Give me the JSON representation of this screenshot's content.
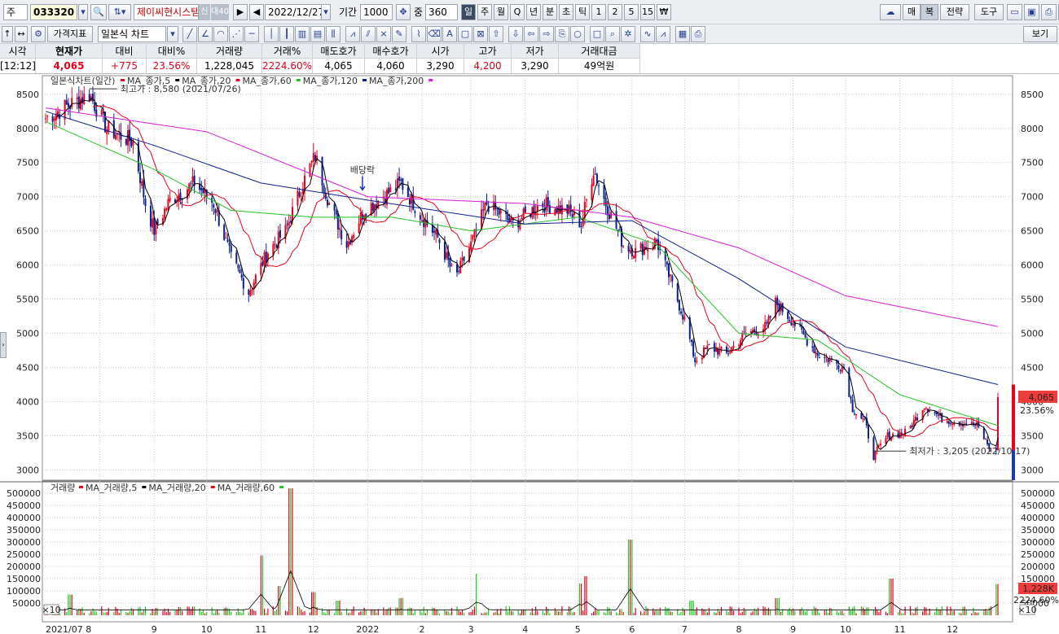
{
  "toolbar1": {
    "market_label": "주",
    "code": "033320",
    "name": "제이씨현시스템",
    "badge_credit": "신",
    "badge_margin": "대40",
    "date": "2022/12/27",
    "period_label": "기간",
    "period_value": "1000",
    "overlap_label": "중",
    "overlap_value": "360",
    "periods": [
      "일",
      "주",
      "월",
      "Q",
      "년",
      "분",
      "초",
      "틱",
      "1",
      "2",
      "5",
      "15",
      "₩"
    ],
    "right_buttons": [
      "매",
      "복",
      "전략",
      "도구"
    ]
  },
  "toolbar2": {
    "indicator_button": "가격지표",
    "chart_type": "일본식 차트",
    "view_button": "보기"
  },
  "quote": {
    "headers": [
      "시각",
      "현재가",
      "대비",
      "대비%",
      "거래량",
      "거래%",
      "매도호가",
      "매수호가",
      "시가",
      "고가",
      "저가",
      "거래대금"
    ],
    "values": [
      "[12:12]",
      "4,065",
      "+775",
      "23.56%",
      "1,228,045",
      "2224.60%",
      "4,065",
      "4,060",
      "3,290",
      "4,200",
      "3,290",
      "49억원"
    ]
  },
  "price_legend": {
    "title": "일본식차트(일간)",
    "items": [
      {
        "label": "MA_종가,5",
        "color": "#e8001c"
      },
      {
        "label": "MA_종가,20",
        "color": "#000000"
      },
      {
        "label": "MA_종가,60",
        "color": "#e8001c"
      },
      {
        "label": "MA_종가,120",
        "color": "#22c322"
      },
      {
        "label": "MA_종가,200",
        "color": "#0b1f8f"
      }
    ],
    "last_marker_color": "#d81bd8"
  },
  "annotations": {
    "high": "최고가 : 8,580 (2021/07/26)",
    "low": "최저가 : 3,205 (2022/10/17)",
    "dividend": "배당락"
  },
  "price_badge": {
    "price": "4,065",
    "change": "23.56%"
  },
  "volume_legend": {
    "title": "거래량",
    "items": [
      {
        "label": "MA_거래량,5",
        "color": "#e8001c"
      },
      {
        "label": "MA_거래량,20",
        "color": "#000000"
      },
      {
        "label": "MA_거래량,60",
        "color": "#e8001c"
      }
    ],
    "last_marker_color": "#22c322"
  },
  "volume_badge": {
    "volume": "1,228K",
    "ratio": "2224.60%"
  },
  "scale_tag": "×10",
  "colors": {
    "up": "#e8001c",
    "down": "#0b1f8f",
    "ma5": "#e8001c",
    "ma20": "#000000",
    "ma60": "#e8001c",
    "ma120": "#22c322",
    "ma200": "#0b1f8f",
    "ma200_alt": "#d81bd8"
  },
  "chart_data": [
    {
      "type": "candlestick",
      "title": "일본식차트(일간)",
      "y_ticks": [
        8500,
        8000,
        7500,
        7000,
        6500,
        6000,
        5500,
        5000,
        4500,
        4000,
        3500,
        3000
      ],
      "ylim": [
        2850,
        8700
      ],
      "x_ticks": [
        "2021/07 8",
        "9",
        "10",
        "11",
        "12",
        "2022",
        "2",
        "3",
        "4",
        "5",
        "6",
        "7",
        "8",
        "9",
        "10",
        "11",
        "12"
      ],
      "close_path": [
        [
          "2021-07-01",
          8150
        ],
        [
          "2021-07-15",
          8350
        ],
        [
          "2021-07-26",
          8500
        ],
        [
          "2021-08-05",
          8000
        ],
        [
          "2021-08-20",
          7800
        ],
        [
          "2021-08-27",
          6900
        ],
        [
          "2021-09-01",
          6500
        ],
        [
          "2021-09-10",
          6950
        ],
        [
          "2021-09-24",
          7200
        ],
        [
          "2021-10-05",
          6900
        ],
        [
          "2021-10-15",
          6100
        ],
        [
          "2021-10-25",
          5600
        ],
        [
          "2021-11-05",
          6200
        ],
        [
          "2021-11-15",
          6500
        ],
        [
          "2021-11-25",
          7200
        ],
        [
          "2021-12-02",
          7600
        ],
        [
          "2021-12-10",
          6900
        ],
        [
          "2021-12-20",
          6300
        ],
        [
          "2021-12-30",
          6800
        ],
        [
          "2022-01-10",
          7000
        ],
        [
          "2022-01-20",
          7200
        ],
        [
          "2022-02-01",
          6700
        ],
        [
          "2022-02-10",
          6400
        ],
        [
          "2022-02-20",
          5800
        ],
        [
          "2022-03-01",
          6300
        ],
        [
          "2022-03-10",
          6900
        ],
        [
          "2022-03-25",
          6600
        ],
        [
          "2022-04-10",
          6900
        ],
        [
          "2022-04-25",
          6800
        ],
        [
          "2022-05-03",
          6600
        ],
        [
          "2022-05-10",
          7400
        ],
        [
          "2022-05-17",
          6900
        ],
        [
          "2022-05-27",
          6300
        ],
        [
          "2022-06-03",
          6200
        ],
        [
          "2022-06-15",
          6350
        ],
        [
          "2022-06-24",
          5700
        ],
        [
          "2022-07-01",
          5200
        ],
        [
          "2022-07-07",
          4600
        ],
        [
          "2022-07-15",
          4800
        ],
        [
          "2022-07-25",
          4700
        ],
        [
          "2022-08-05",
          5000
        ],
        [
          "2022-08-17",
          5100
        ],
        [
          "2022-08-22",
          5450
        ],
        [
          "2022-08-31",
          5200
        ],
        [
          "2022-09-15",
          4700
        ],
        [
          "2022-09-30",
          4500
        ],
        [
          "2022-10-05",
          3900
        ],
        [
          "2022-10-12",
          3700
        ],
        [
          "2022-10-17",
          3205
        ],
        [
          "2022-10-25",
          3500
        ],
        [
          "2022-11-05",
          3550
        ],
        [
          "2022-11-15",
          3950
        ],
        [
          "2022-11-25",
          3750
        ],
        [
          "2022-12-05",
          3700
        ],
        [
          "2022-12-15",
          3650
        ],
        [
          "2022-12-23",
          3290
        ],
        [
          "2022-12-27",
          4065
        ]
      ],
      "ma200_path": [
        [
          "2021-07-01",
          8300
        ],
        [
          "2021-10-01",
          7950
        ],
        [
          "2022-01-01",
          7000
        ],
        [
          "2022-04-01",
          6900
        ],
        [
          "2022-06-01",
          6700
        ],
        [
          "2022-08-01",
          6250
        ],
        [
          "2022-10-01",
          5550
        ],
        [
          "2022-12-27",
          5100
        ]
      ],
      "ma120_path": [
        [
          "2021-07-01",
          8250
        ],
        [
          "2021-09-01",
          7750
        ],
        [
          "2021-11-01",
          7200
        ],
        [
          "2022-01-01",
          6950
        ],
        [
          "2022-04-01",
          6600
        ],
        [
          "2022-06-01",
          6650
        ],
        [
          "2022-08-01",
          5800
        ],
        [
          "2022-10-01",
          4800
        ],
        [
          "2022-12-27",
          4250
        ]
      ],
      "ma60_path": [
        [
          "2021-07-01",
          8100
        ],
        [
          "2021-09-01",
          7400
        ],
        [
          "2021-10-15",
          6800
        ],
        [
          "2021-12-01",
          6700
        ],
        [
          "2022-01-15",
          6700
        ],
        [
          "2022-03-01",
          6500
        ],
        [
          "2022-05-01",
          6700
        ],
        [
          "2022-06-15",
          6300
        ],
        [
          "2022-08-01",
          5000
        ],
        [
          "2022-09-15",
          4900
        ],
        [
          "2022-11-01",
          4100
        ],
        [
          "2022-12-27",
          3650
        ]
      ]
    },
    {
      "type": "bar",
      "title": "거래량",
      "y_ticks": [
        500000,
        450000,
        400000,
        350000,
        300000,
        250000,
        200000,
        150000,
        100000,
        50000
      ],
      "ylim": [
        0,
        530000
      ],
      "spikes": [
        [
          "2021-07-15",
          85000
        ],
        [
          "2021-10-10",
          30000
        ],
        [
          "2021-11-01",
          245000
        ],
        [
          "2021-11-12",
          120000
        ],
        [
          "2021-11-18",
          520000
        ],
        [
          "2021-12-01",
          95000
        ],
        [
          "2021-12-15",
          60000
        ],
        [
          "2022-01-20",
          70000
        ],
        [
          "2022-03-05",
          170000
        ],
        [
          "2022-05-02",
          130000
        ],
        [
          "2022-05-06",
          160000
        ],
        [
          "2022-05-31",
          310000
        ],
        [
          "2022-07-05",
          60000
        ],
        [
          "2022-08-23",
          70000
        ],
        [
          "2022-10-27",
          150000
        ],
        [
          "2022-12-27",
          128000
        ]
      ],
      "base_volume": 25000
    }
  ]
}
